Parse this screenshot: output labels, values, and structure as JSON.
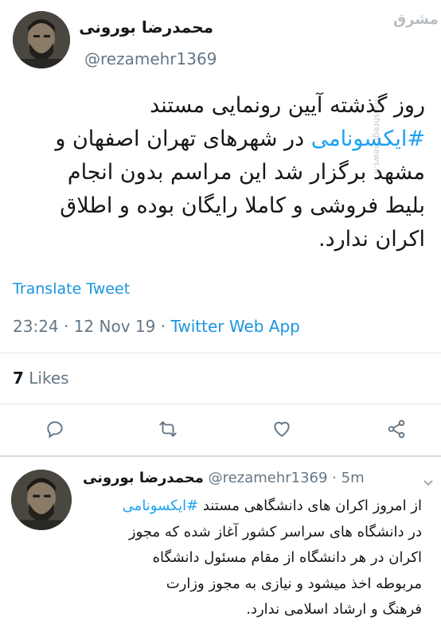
{
  "tweet": {
    "author_name": "محمدرضا بورونی",
    "handle": "@rezamehr1369",
    "text_lines": [
      "روز گذشته آیین رونمایی مستند",
      "#ایکسونامی در شهرهای تهران اصفهان و",
      "مشهد برگزار شد این مراسم بدون انجام",
      "بلیط فروشی و کاملا رایگان بوده و اطلاق",
      "اکران ندارد."
    ],
    "hashtag": "#ایکسونامی",
    "line2_rest": " در شهرهای تهران اصفهان و",
    "translate_label": "Translate Tweet",
    "time": "23:24 · 12 Nov 19 · ",
    "source": "Twitter Web App",
    "likes_count": "7",
    "likes_label": " Likes"
  },
  "reply": {
    "author_name": "محمدرضا بورونی",
    "handle_time": "@rezamehr1369 · 5m",
    "text_lines": [
      "از امروز اکران های دانشگاهی مستند #ایکسونامی",
      "در دانشگاه های سراسر کشور آغاز شده که مجوز",
      "اکران در هر دانشگاه از مقام مسئول دانشگاه",
      "مربوطه اخذ میشود و نیازی به مجوز وزارت",
      "فرهنگ و ارشاد اسلامی ندارد."
    ],
    "line1_pre": "از امروز اکران های دانشگاهی مستند ",
    "hashtag": "#ایکسونامی"
  },
  "watermark": {
    "logo_text": "مشرق",
    "url": "mashreghnews.ir"
  },
  "icons": [
    "reply-icon",
    "retweet-icon",
    "like-icon",
    "share-icon",
    "chevron-down-icon"
  ],
  "colors": {
    "link": "#1b95e0",
    "hashtag": "#1da1f2",
    "muted": "#657786",
    "divider": "#e1e8ed"
  }
}
